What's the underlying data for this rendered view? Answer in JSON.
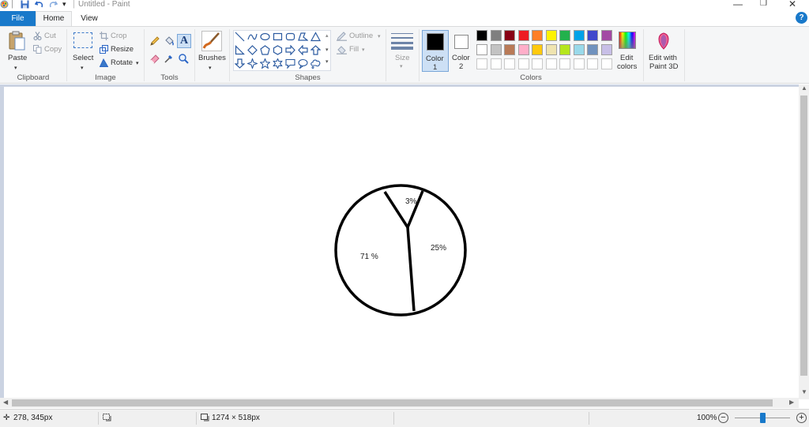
{
  "window": {
    "title": "Untitled - Paint"
  },
  "tabs": {
    "file": "File",
    "home": "Home",
    "view": "View"
  },
  "clipboard": {
    "paste": "Paste",
    "cut": "Cut",
    "copy": "Copy",
    "label": "Clipboard"
  },
  "image": {
    "select": "Select",
    "crop": "Crop",
    "resize": "Resize",
    "rotate": "Rotate",
    "label": "Image"
  },
  "tools": {
    "label": "Tools",
    "items": [
      "pencil-icon",
      "fill-bucket-icon",
      "text-icon",
      "eraser-icon",
      "color-picker-icon",
      "magnifier-icon"
    ]
  },
  "brushes": {
    "label": "Brushes"
  },
  "shapes": {
    "label": "Shapes",
    "outline": "Outline",
    "fill": "Fill"
  },
  "size": {
    "label": "Size"
  },
  "colors": {
    "label": "Colors",
    "color1_line1": "Color",
    "color1_line2": "1",
    "color2_line1": "Color",
    "color2_line2": "2",
    "edit_line1": "Edit",
    "edit_line2": "colors",
    "edit3d_line1": "Edit with",
    "edit3d_line2": "Paint 3D",
    "color1_value": "#000000",
    "color2_value": "#ffffff",
    "palette_row1": [
      "#000000",
      "#7f7f7f",
      "#880015",
      "#ed1c24",
      "#ff7f27",
      "#fff200",
      "#22b14c",
      "#00a2e8",
      "#3f48cc",
      "#a349a4"
    ],
    "palette_row2": [
      "#ffffff",
      "#c3c3c3",
      "#b97a57",
      "#ffaec9",
      "#ffc90e",
      "#efe4b0",
      "#b5e61d",
      "#99d9ea",
      "#7092be",
      "#c8bfe7"
    ]
  },
  "drawing": {
    "slice_small": "3%",
    "slice_right": "25%",
    "slice_left": "71 %"
  },
  "status": {
    "cursor_pos": "278, 345px",
    "canvas_size": "1274 × 518px",
    "zoom": "100%"
  }
}
